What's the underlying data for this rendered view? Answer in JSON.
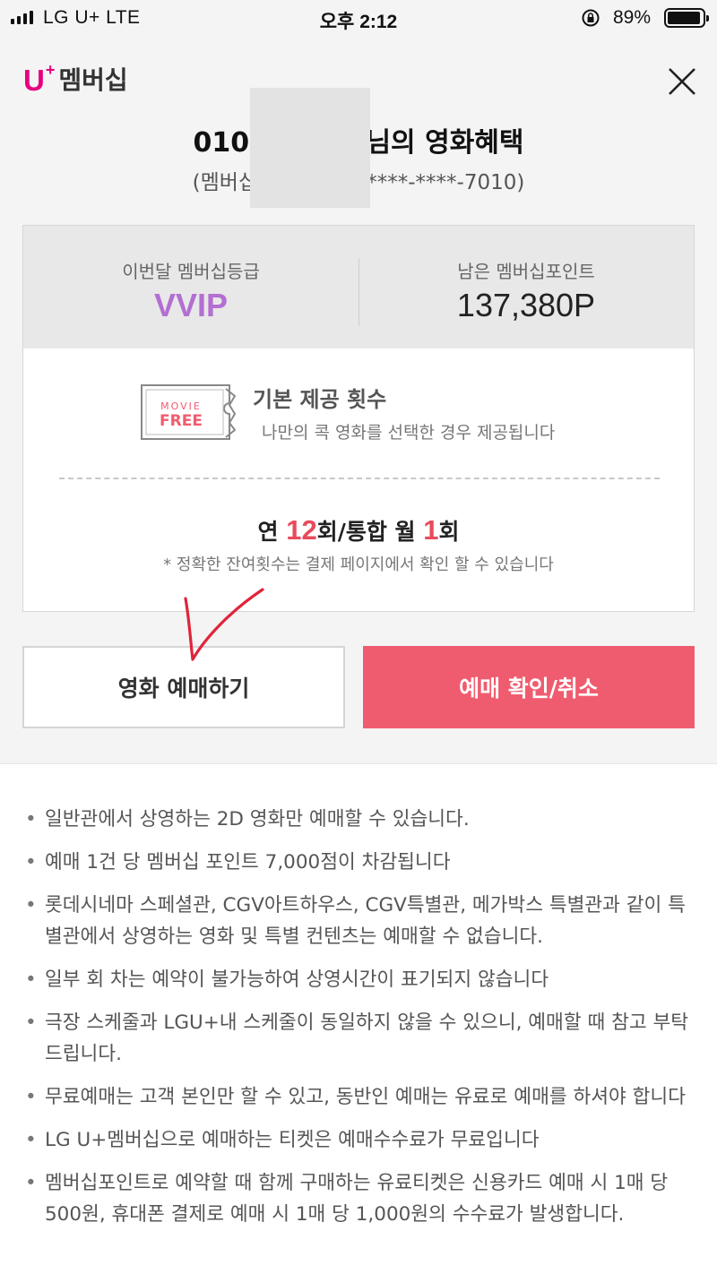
{
  "status_bar": {
    "carrier": "LG U+   LTE",
    "time": "오후 2:12",
    "battery_percent": "89%",
    "battery_level": 0.89
  },
  "header": {
    "logo_u": "U",
    "logo_plus": "+",
    "logo_text": "멤버십",
    "close_icon": "close-icon"
  },
  "customer": {
    "title": "010-**4         고객님의 영화혜택",
    "card_line": "(멤버십 카드번호         3-****-****-7010)"
  },
  "summary": {
    "grade_label": "이번달 멤버십등급",
    "grade_value": "VVIP",
    "points_label": "남은 멤버십포인트",
    "points_value": "137,380P"
  },
  "benefit": {
    "ticket_line1": "MOVIE",
    "ticket_line2": "FREE",
    "title": "기본 제공 횟수",
    "description": "나만의 콕 영화를 선택한 경우 제공됩니다",
    "count_prefix": "연 ",
    "count_year": "12",
    "count_middle": "회/통합 월 ",
    "count_month": "1",
    "count_suffix": "회",
    "note": "* 정확한 잔여횟수는 결제 페이지에서 확인 할 수 있습니다"
  },
  "buttons": {
    "reserve": "영화 예매하기",
    "confirm_cancel": "예매 확인/취소"
  },
  "notices": [
    "일반관에서 상영하는 2D 영화만 예매할 수 있습니다.",
    "예매 1건 당 멤버십 포인트 7,000점이 차감됩니다",
    "롯데시네마 스페셜관, CGV아트하우스, CGV특별관, 메가박스 특별관과 같이 특별관에서 상영하는 영화 및 특별 컨텐츠는 예매할 수 없습니다.",
    "일부 회 차는 예약이 불가능하여 상영시간이 표기되지 않습니다",
    "극장 스케줄과 LGU+내 스케줄이 동일하지 않을 수 있으니, 예매할 때 참고 부탁드립니다.",
    "무료예매는 고객 본인만 할 수 있고, 동반인 예매는 유료로 예매를 하셔야 합니다",
    "LG U+멤버십으로 예매하는 티켓은 예매수수료가 무료입니다",
    "멤버십포인트로 예약할 때 함께 구매하는 유료티켓은 신용카드 예매 시 1매 당 500원, 휴대폰 결제로 예매 시 1매 당 1,000원의 수수료가 발생합니다."
  ],
  "colors": {
    "brand": "#e6007e",
    "grade": "#b36fd2",
    "accent": "#f05c6f",
    "count_highlight": "#e84b5c",
    "annotation": "#e0243a"
  }
}
